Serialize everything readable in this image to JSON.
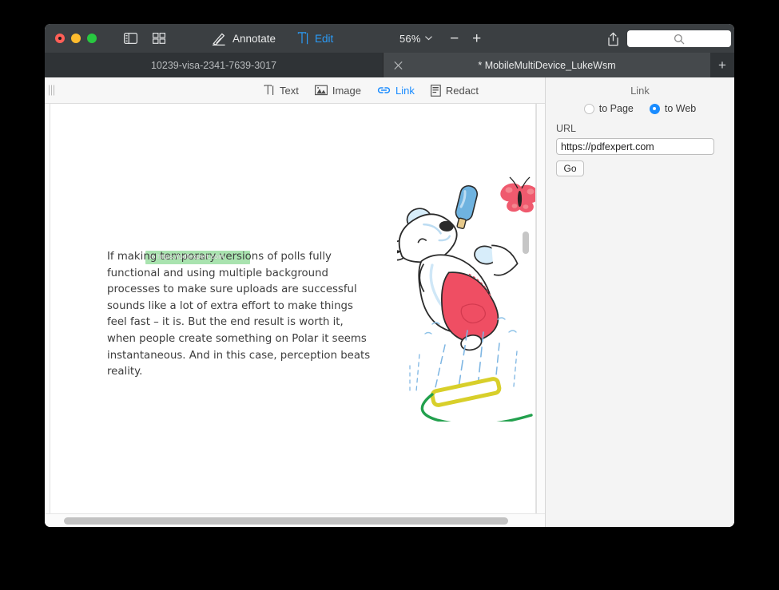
{
  "window": {
    "titlebar": {
      "traffic_lights": [
        "close",
        "minimize",
        "zoom"
      ],
      "sidebar_toggle_icon": "sidebar-icon",
      "grid_toggle_icon": "grid-icon",
      "annotate_label": "Annotate",
      "annotate_icon": "pen-icon",
      "edit_label": "Edit",
      "edit_icon": "text-cursor-icon",
      "zoom_value": "56%",
      "zoom_chevron_icon": "chevron-down-icon",
      "zoom_out_label": "−",
      "zoom_in_label": "+",
      "share_icon": "share-icon",
      "search_icon": "search-icon",
      "search_value": "",
      "search_placeholder": ""
    },
    "tabs": [
      {
        "label": "10239-visa-2341-7639-3017",
        "active": false,
        "closable": false
      },
      {
        "label": "* MobileMultiDevice_LukeWsm",
        "active": true,
        "closable": true,
        "close_icon": "close-icon"
      }
    ],
    "new_tab_label": "+"
  },
  "edit_toolbar": {
    "grip_icon": "drag-grip-icon",
    "items": [
      {
        "label": "Text",
        "icon": "text-icon",
        "active": false
      },
      {
        "label": "Image",
        "icon": "image-icon",
        "active": false
      },
      {
        "label": "Link",
        "icon": "link-icon",
        "active": true
      },
      {
        "label": "Redact",
        "icon": "redact-icon",
        "active": false
      }
    ]
  },
  "document": {
    "paragraph": "If making temporary versions of polls fully functional and using multiple background processes to make sure uploads are successful sounds like a lot of extra effort to make things feel fast – it is. But the end result is worth it, when people create something on Polar it seems instantaneous. And in this case, perception beats reality.",
    "link_tooltip": "to https://pdfexpert.com",
    "highlight_color": "#a9e3af",
    "illustration": "polar-bear-with-ice-cream-sprinkler-butterfly"
  },
  "link_panel": {
    "title": "Link",
    "options": [
      {
        "label": "to Page",
        "selected": false
      },
      {
        "label": "to Web",
        "selected": true
      }
    ],
    "url_label": "URL",
    "url_value": "https://pdfexpert.com",
    "url_placeholder": "https://",
    "go_label": "Go",
    "accent_color": "#1a8cff"
  }
}
